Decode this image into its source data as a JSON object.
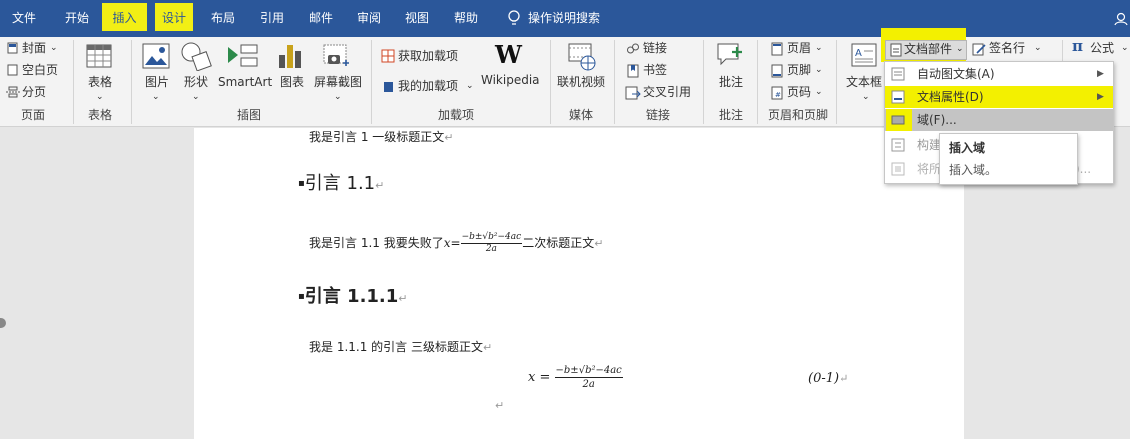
{
  "tabs": [
    {
      "key": "file",
      "label": "文件"
    },
    {
      "key": "home",
      "label": "开始"
    },
    {
      "key": "insert",
      "label": "插入"
    },
    {
      "key": "design",
      "label": "设计"
    },
    {
      "key": "layout",
      "label": "布局"
    },
    {
      "key": "references",
      "label": "引用"
    },
    {
      "key": "mailings",
      "label": "邮件"
    },
    {
      "key": "review",
      "label": "审阅"
    },
    {
      "key": "view",
      "label": "视图"
    },
    {
      "key": "help",
      "label": "帮助"
    }
  ],
  "tell_me": "操作说明搜索",
  "groups": {
    "pages": {
      "label": "页面",
      "items": [
        "封面",
        "空白页",
        "分页"
      ]
    },
    "tables": {
      "label": "表格",
      "items": [
        "表格"
      ]
    },
    "illustrations": {
      "label": "插图",
      "items": [
        "图片",
        "形状",
        "SmartArt",
        "图表",
        "屏幕截图"
      ]
    },
    "addins": {
      "label": "加载项",
      "items": [
        "获取加载项",
        "我的加载项",
        "Wikipedia"
      ]
    },
    "media": {
      "label": "媒体",
      "items": [
        "联机视频"
      ]
    },
    "links": {
      "label": "链接",
      "items": [
        "链接",
        "书签",
        "交叉引用"
      ]
    },
    "comments": {
      "label": "批注",
      "items": [
        "批注"
      ]
    },
    "header_footer": {
      "label": "页眉和页脚",
      "items": [
        "页眉",
        "页脚",
        "页码"
      ]
    },
    "text": {
      "items": [
        "文本框",
        "文档部件",
        "签名行",
        "公式"
      ]
    }
  },
  "wikipedia_glyph": "W",
  "quick_parts_menu": {
    "items": [
      "自动图文集(A)",
      "文档属性(D)",
      "域(F)...",
      "构建",
      "将所"
    ],
    "trailing_fragment": ")..."
  },
  "tooltip": {
    "title": "插入域",
    "body": "插入域。"
  },
  "document": {
    "line1": "我是引言 1 一级标题正文",
    "h2": "引言 1.1",
    "p2_pre": "我是引言 1.1 我要失败了",
    "p2_post": "二次标题正文",
    "eq_lhs": "x",
    "eq_equals": "=",
    "eq_num": "−b±√b²−4ac",
    "eq_den": "2a",
    "h3": "引言 1.1.1",
    "p3": "我是 1.1.1 的引言 三级标题正文",
    "eq_number": "(0-1)",
    "return_mark": "↵"
  }
}
